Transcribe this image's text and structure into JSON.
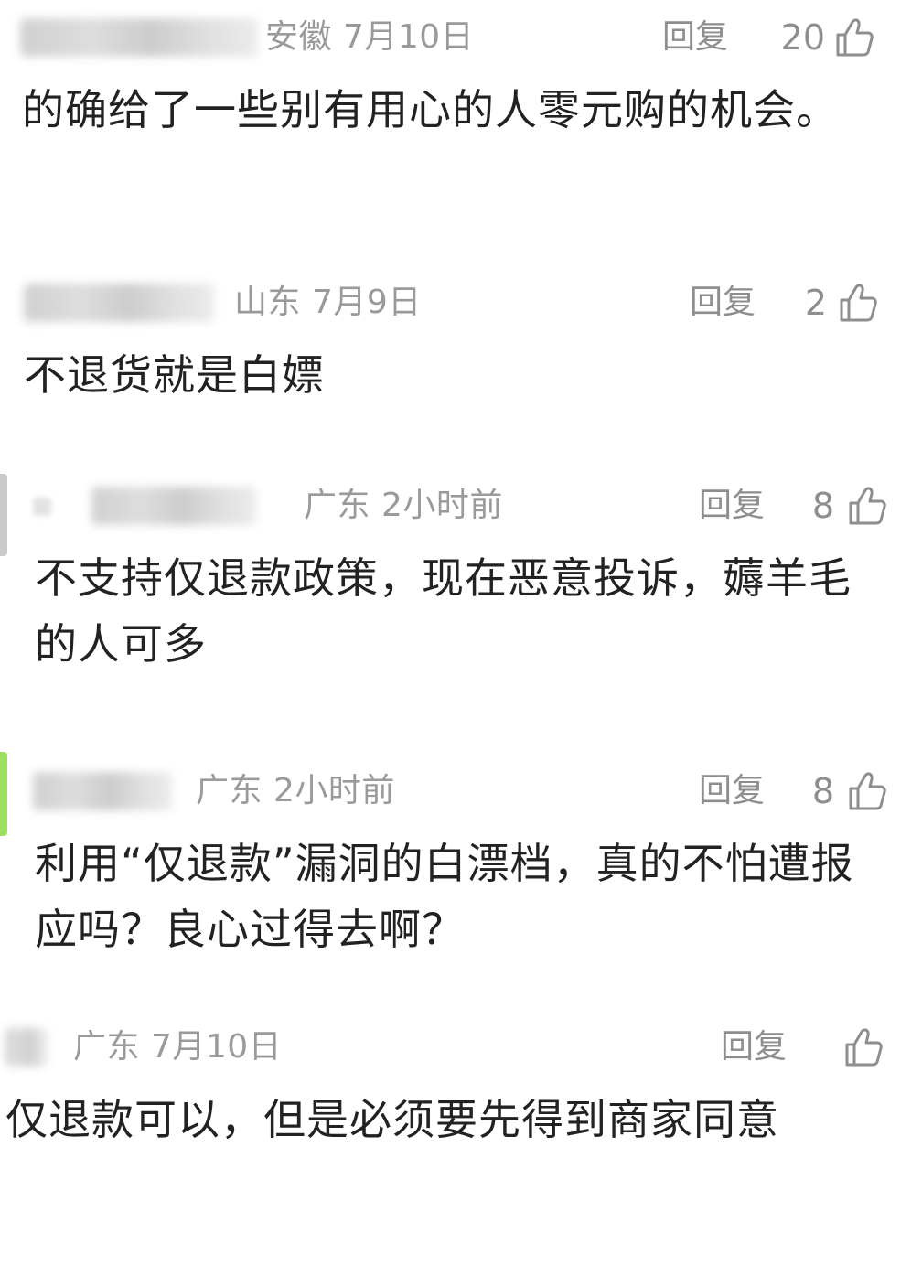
{
  "comments": [
    {
      "location": "安徽",
      "date": "7月10日",
      "reply_label": "回复",
      "likes": "20",
      "text": "的确给了一些别有用心的人零元购的机会。"
    },
    {
      "location": "山东",
      "date": "7月9日",
      "reply_label": "回复",
      "likes": "2",
      "text": "不退货就是白嫖"
    },
    {
      "location": "广东",
      "date": "2小时前",
      "reply_label": "回复",
      "likes": "8",
      "text": "不支持仅退款政策，现在恶意投诉，薅羊毛的人可多"
    },
    {
      "location": "广东",
      "date": "2小时前",
      "reply_label": "回复",
      "likes": "8",
      "text": "利用“仅退款”漏洞的白漂档，真的不怕遭报应吗？良心过得去啊？"
    },
    {
      "location": "广东",
      "date": "7月10日",
      "reply_label": "回复",
      "likes": "",
      "text": "仅退款可以，但是必须要先得到商家同意"
    }
  ],
  "colors": {
    "meta": "#9a9a9a",
    "body_text": "#222222",
    "edge_green": "#9be15d",
    "edge_gray": "#c9c9c9"
  },
  "icons": {
    "like": "thumbs-up-icon"
  }
}
